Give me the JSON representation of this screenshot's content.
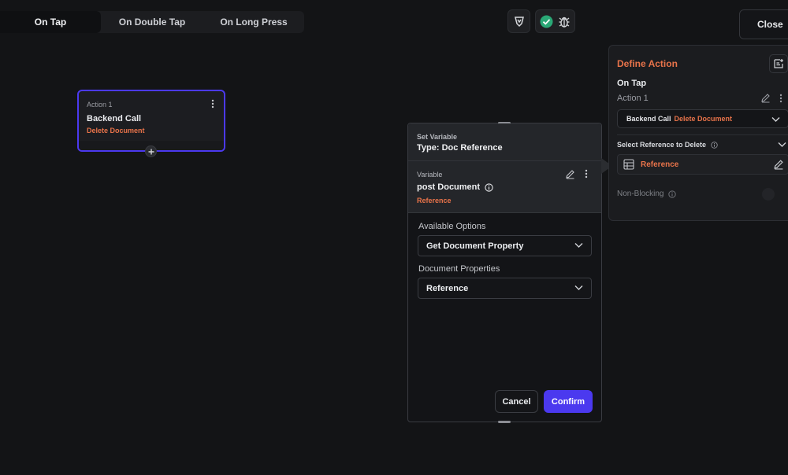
{
  "tabs": [
    {
      "label": "On Tap",
      "active": true
    },
    {
      "label": "On Double Tap",
      "active": false
    },
    {
      "label": "On Long Press",
      "active": false
    }
  ],
  "toolbar": {
    "icons": [
      "agent-icon",
      "check-circle-icon",
      "debug-bug-icon"
    ],
    "close_label": "Close"
  },
  "node": {
    "label": "Action 1",
    "title": "Backend Call",
    "subtitle": "Delete Document"
  },
  "popup": {
    "section_label": "Set Variable",
    "type_label": "Type: Doc Reference",
    "variable_label": "Variable",
    "variable_name": "post Document",
    "variable_type": "Reference",
    "available_options_label": "Available Options",
    "available_options_value": "Get Document Property",
    "document_properties_label": "Document Properties",
    "document_properties_value": "Reference",
    "cancel_label": "Cancel",
    "confirm_label": "Confirm"
  },
  "panel": {
    "title": "Define Action",
    "trigger": "On Tap",
    "action_name": "Action 1",
    "action_type": "Backend Call",
    "action_subtype": "Delete Document",
    "select_reference_label": "Select Reference to Delete",
    "reference_value": "Reference",
    "non_blocking_label": "Non-Blocking"
  },
  "colors": {
    "accent": "#4b39ef",
    "orange": "#e8734a",
    "success": "#2aa876",
    "background": "#131416"
  }
}
